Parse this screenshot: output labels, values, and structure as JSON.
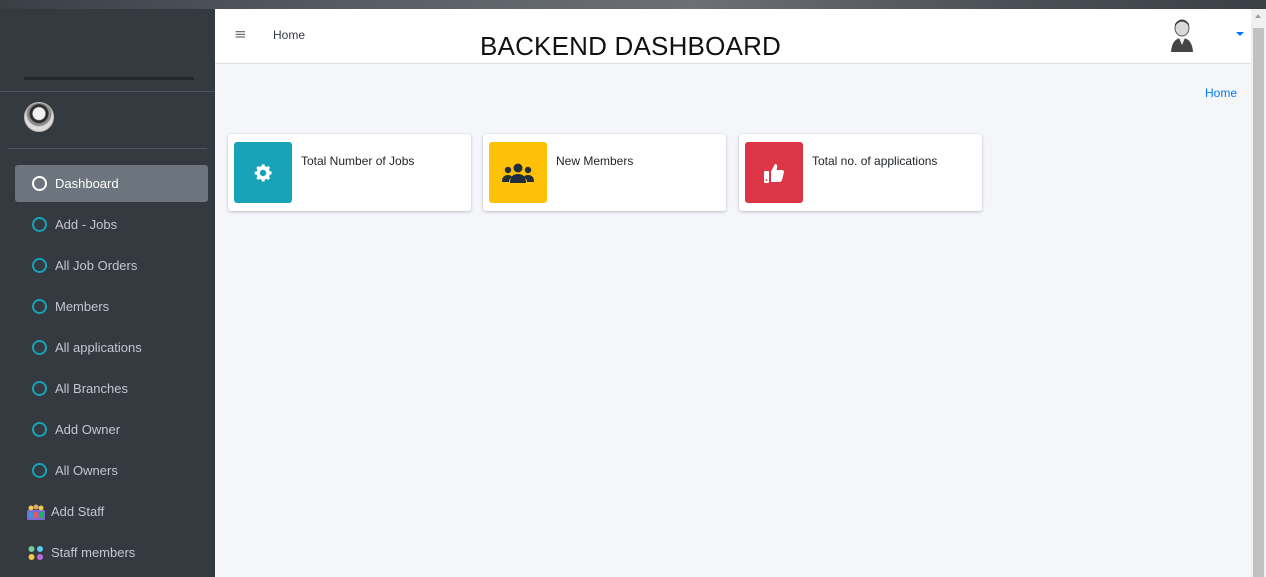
{
  "header": {
    "home_link": "Home",
    "title": "BACKEND DASHBOARD"
  },
  "breadcrumb": {
    "current": "Home"
  },
  "sidebar": {
    "items": [
      {
        "label": "Dashboard",
        "icon": "circle-icon",
        "active": true
      },
      {
        "label": "Add - Jobs",
        "icon": "circle-icon"
      },
      {
        "label": "All Job Orders",
        "icon": "circle-icon"
      },
      {
        "label": "Members",
        "icon": "circle-icon"
      },
      {
        "label": "All applications",
        "icon": "circle-icon"
      },
      {
        "label": "All Branches",
        "icon": "circle-icon"
      },
      {
        "label": "Add Owner",
        "icon": "circle-icon"
      },
      {
        "label": "All Owners",
        "icon": "circle-icon"
      },
      {
        "label": "Add Staff",
        "icon": "staff-group-icon"
      },
      {
        "label": "Staff members",
        "icon": "staff-members-icon"
      }
    ]
  },
  "cards": [
    {
      "label": "Total Number of Jobs",
      "icon": "gear-icon",
      "color": "#17a2b8"
    },
    {
      "label": "New Members",
      "icon": "users-icon",
      "color": "#ffc107"
    },
    {
      "label": "Total no. of applications",
      "icon": "thumbs-up-icon",
      "color": "#dc3545"
    }
  ],
  "colors": {
    "sidebar_bg": "#343a40",
    "active_item_bg": "#6c757d",
    "accent_info": "#17a2b8",
    "accent_warning": "#ffc107",
    "accent_danger": "#dc3545",
    "link": "#007bff"
  }
}
